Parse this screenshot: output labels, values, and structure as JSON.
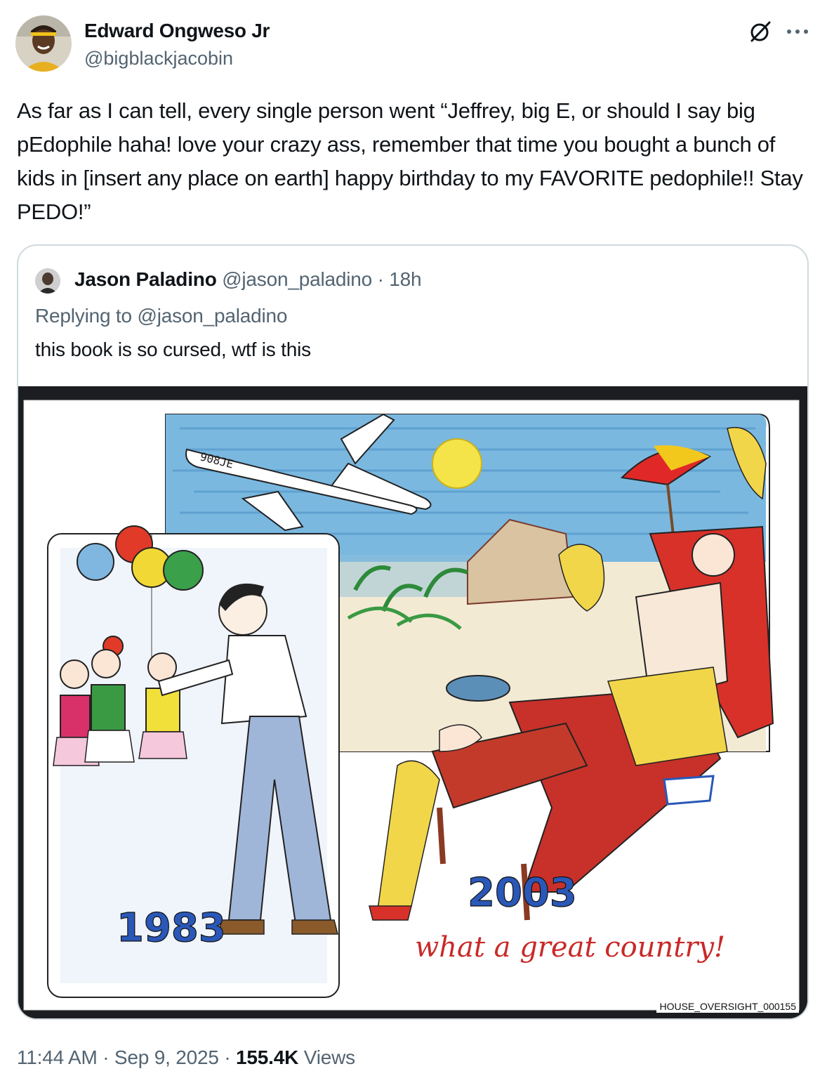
{
  "author": {
    "display_name": "Edward Ongweso Jr",
    "handle": "@bigblackjacobin",
    "avatar_icon": "profile-photo"
  },
  "tweet": {
    "text": "As far as I can tell, every single person went “Jeffrey, big E, or should I say big pEdophile haha! love your crazy ass, remember that time you bought a bunch of kids in [insert any place on earth] happy birthday to my FAVORITE pedophile!! Stay PEDO!”"
  },
  "quote": {
    "display_name": "Jason Paladino",
    "handle": "@jason_paladino",
    "separator": " · ",
    "time": "18h",
    "replying_to_prefix": "Replying to ",
    "replying_to_handle": "@jason_paladino",
    "text": "this book is so cursed, wtf is this",
    "image": {
      "plane_marking": "908JE",
      "year_left": "1983",
      "year_right": "2003",
      "caption": "what a great country!",
      "watermark": "HOUSE_OVERSIGHT_000155"
    }
  },
  "footer": {
    "time": "11:44 AM",
    "dot1": " · ",
    "date": "Sep 9, 2025",
    "dot2": " · ",
    "views_count": "155.4K",
    "views_label": " Views"
  },
  "colors": {
    "text_primary": "#0f1419",
    "text_secondary": "#536471",
    "border": "#cfd9de"
  }
}
